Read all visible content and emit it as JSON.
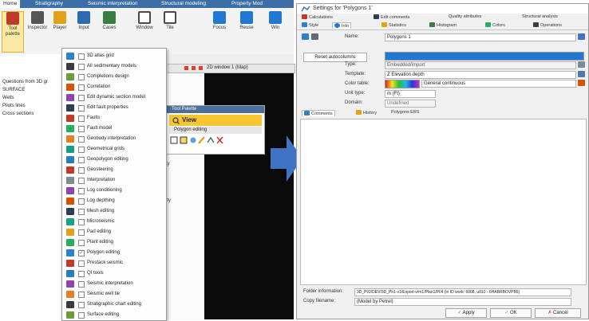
{
  "left_app": {
    "ribbon_tabs": [
      "Home",
      "Stratigraphy",
      "Seismic interpretation",
      "Structural modeling",
      "Property Mod"
    ],
    "ribbon_buttons": [
      {
        "label": "Tool palette",
        "icon": "toolbox-icon",
        "color": "#c0392b"
      },
      {
        "label": "Inspector",
        "icon": "inspector-icon",
        "color": "#555555"
      },
      {
        "label": "Player",
        "icon": "player-icon",
        "color": "#e1a21a"
      },
      {
        "label": "Input",
        "icon": "input-icon",
        "color": "#2b6cb0"
      },
      {
        "label": "Cases",
        "icon": "cases-icon",
        "color": "#3a7d44"
      },
      {
        "label": "Window",
        "icon": "window-icon",
        "color": "#4a4a4a"
      },
      {
        "label": "Tile",
        "icon": "tile-icon",
        "color": "#4a4a4a"
      },
      {
        "label": "Focus",
        "icon": "focus-icon",
        "color": "#1f79d4"
      },
      {
        "label": "Reuse",
        "icon": "reuse-icon",
        "color": "#1f79d4"
      },
      {
        "label": "Win",
        "icon": "win-icon",
        "color": "#1f79d4"
      }
    ],
    "left_panel_items": [
      "Questions from 3D gr",
      "SURFACE",
      "Wells",
      "Pilots lines",
      "Cross sections"
    ],
    "window_title": "2D window 1 (Map)",
    "window_mid_labels": [
      "ty",
      "ity"
    ],
    "float_panel": {
      "title": "Tool Palette",
      "view_label": "View",
      "sub_label": "Polygon editing"
    },
    "dropdown_items": [
      {
        "label": "3D atlas grid",
        "checked": false,
        "color": "#2f7fcf"
      },
      {
        "label": "All sedimentary models",
        "checked": false,
        "color": "#3b3b3b"
      },
      {
        "label": "Completions design",
        "checked": false,
        "color": "#6b9b3a"
      },
      {
        "label": "Correlation",
        "checked": false,
        "color": "#d35400"
      },
      {
        "label": "Edit dynamic section model",
        "checked": false,
        "color": "#8e44ad"
      },
      {
        "label": "Edit fault properties",
        "checked": false,
        "color": "#2c3e50"
      },
      {
        "label": "Faults",
        "checked": false,
        "color": "#c0392b"
      },
      {
        "label": "Fault model",
        "checked": false,
        "color": "#27ae60"
      },
      {
        "label": "Geobody interpretation",
        "checked": false,
        "color": "#e67e22"
      },
      {
        "label": "Geometrical grids",
        "checked": false,
        "color": "#16a085"
      },
      {
        "label": "Geopolygon editing",
        "checked": false,
        "color": "#2980b9"
      },
      {
        "label": "Geosteering",
        "checked": false,
        "color": "#c0392b"
      },
      {
        "label": "Interpretation",
        "checked": false,
        "color": "#7f8c8d"
      },
      {
        "label": "Log conditioning",
        "checked": false,
        "color": "#8e44ad"
      },
      {
        "label": "Log depthing",
        "checked": false,
        "color": "#d35400"
      },
      {
        "label": "Mesh editing",
        "checked": false,
        "color": "#2c3e50"
      },
      {
        "label": "Microseismic",
        "checked": false,
        "color": "#16a085"
      },
      {
        "label": "Pad editing",
        "checked": false,
        "color": "#e1a21a"
      },
      {
        "label": "Plant editing",
        "checked": false,
        "color": "#27ae60"
      },
      {
        "label": "Polygon editing",
        "checked": true,
        "color": "#2f7fcf"
      },
      {
        "label": "Prestack seismic",
        "checked": false,
        "color": "#c0392b"
      },
      {
        "label": "QI tools",
        "checked": false,
        "color": "#2980b9"
      },
      {
        "label": "Seismic interpretation",
        "checked": false,
        "color": "#8e44ad"
      },
      {
        "label": "Seismic well tie",
        "checked": false,
        "color": "#e67e22"
      },
      {
        "label": "Stratigraphic chart editing",
        "checked": false,
        "color": "#3b3b3b"
      },
      {
        "label": "Surface editing",
        "checked": false,
        "color": "#6b9b3a"
      }
    ]
  },
  "dialog": {
    "title": "Settings for 'Polygons 1'",
    "tabs_row1": [
      "Calculations",
      "Edit comments",
      "Quality attributes",
      "Structural analysis"
    ],
    "tabs_row2": [
      "Style",
      "Info",
      "Statistics",
      "Histogram",
      "Colors",
      "Operations"
    ],
    "fields": {
      "name_label": "Name:",
      "name_value": "Polygons 1",
      "reset_button": "Reset autocolumns",
      "type_label": "Type:",
      "type_value": "Embedded/import",
      "template_label": "Template:",
      "template_value": "Z  Elevation depth",
      "color_table_label": "Color table:",
      "color_table_value": "General continuous",
      "unit_label": "Unit type:",
      "unit_value": "m  (Ft)",
      "domain_label": "Domain:",
      "domain_value": "Undefined"
    },
    "subtabs": [
      "Comments",
      "History",
      "Polygons ERS"
    ],
    "bottom": {
      "folder_label": "Folder information:",
      "folder_value": "3D_Pl/2/DEV/3D_Plr1-v1/Export-v/m1/Plan1/Pl/4 (in ID work: 6008, u010 - 6HABRBOVPB5)",
      "copy_label": "Copy filename:",
      "copy_value": "(Model by Petrel)",
      "apply_button": "Apply",
      "ok_button": "OK",
      "cancel_button": "Cancel"
    }
  },
  "colors": {
    "arrow": "#3f73c4",
    "ribbon": "#3a6ea5",
    "selected": "#fde9a6",
    "view_bar": "#f6c630",
    "panel_title": "#4b6e9a"
  }
}
